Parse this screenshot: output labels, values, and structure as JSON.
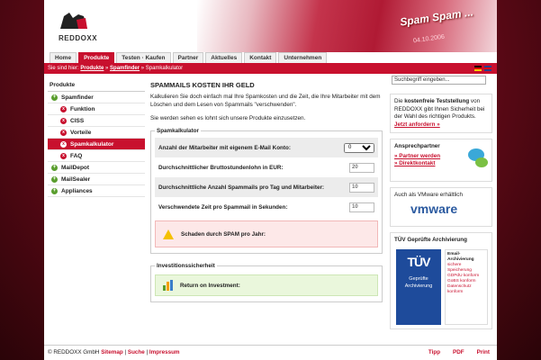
{
  "header": {
    "logo_text": "REDDOXX",
    "banner_text": "Spam Spam ...",
    "banner_date": "04.10.2006"
  },
  "nav": {
    "tabs": [
      "Home",
      "Produkte",
      "Testen · Kaufen",
      "Partner",
      "Aktuelles",
      "Kontakt",
      "Unternehmen"
    ],
    "active": "Produkte"
  },
  "breadcrumb": {
    "prefix": "Sie sind hier: ",
    "item1": "Produkte",
    "sep": " » ",
    "item2": "Spamfinder",
    "current": " » Spamkalkulator"
  },
  "sidebar": {
    "title": "Produkte",
    "items": [
      {
        "label": "Spamfinder",
        "level": 0
      },
      {
        "label": "Funktion",
        "level": 1
      },
      {
        "label": "CISS",
        "level": 1
      },
      {
        "label": "Vorteile",
        "level": 1
      },
      {
        "label": "Spamkalkulator",
        "level": 1,
        "active": true
      },
      {
        "label": "FAQ",
        "level": 1
      },
      {
        "label": "MailDepot",
        "level": 0
      },
      {
        "label": "MailSealer",
        "level": 0
      },
      {
        "label": "Appliances",
        "level": 0
      }
    ]
  },
  "main": {
    "title": "SPAMMAILS KOSTEN IHR GELD",
    "intro": "Kalkulieren Sie doch einfach mal Ihre Spamkosten und die Zeit, die Ihre Mitarbeiter mit dem Löschen und dem Lesen von Spammails \"verschwenden\".",
    "intro2": "Sie werden sehen es lohnt sich unsere Produkte einzusetzen.",
    "calc_legend": "Spamkalkulator",
    "rows": [
      {
        "label": "Anzahl der Mitarbeiter mit eigenem E-Mail Konto:",
        "value": "0",
        "type": "select"
      },
      {
        "label": "Durchschnittlicher Bruttostundenlohn in EUR:",
        "value": "20",
        "type": "input"
      },
      {
        "label": "Durchschnittliche Anzahl Spammails pro Tag und Mitarbeiter:",
        "value": "10",
        "type": "input"
      },
      {
        "label": "Verschwendete Zeit pro Spammail in Sekunden:",
        "value": "10",
        "type": "input"
      }
    ],
    "damage_label": "Schaden durch SPAM pro Jahr:",
    "invest_legend": "Investitionssicherheit",
    "roi_label": "Return on Investment:"
  },
  "right": {
    "search_placeholder": "Suchbegriff eingeben...",
    "trial_text_1": "Die ",
    "trial_text_bold": "kostenfreie Teststellung",
    "trial_text_2": " von REDDOXX gibt Ihnen Sicherheit bei der Wahl des richtigen Produkts.",
    "trial_link": "Jetzt anfordern »",
    "contact_title": "Ansprechpartner",
    "contact_link1": "» Partner werden",
    "contact_link2": "» Direktkontakt",
    "vmware_title": "Auch als VMware erhältlich",
    "vmware_logo": "vmware",
    "tuv_title": "TÜV Geprüfte Archivierung",
    "tuv_seal_big": "TÜV",
    "tuv_seal_text": "Geprüfte Archivierung",
    "tuv_list_title": "Email-Archivierung",
    "tuv_list": [
      "sichere Speicherung",
      "GDPdU konform",
      "GoBS konform",
      "Datenschutz konform"
    ]
  },
  "footer": {
    "copyright": "© REDDOXX GmbH",
    "sitemap": "Sitemap",
    "search": "Suche",
    "impressum": "Impressum",
    "tipp": "Tipp",
    "pdf": "PDF",
    "print": "Print"
  },
  "colors": {
    "brand_red": "#c8102e",
    "green": "#5a9e2e"
  }
}
